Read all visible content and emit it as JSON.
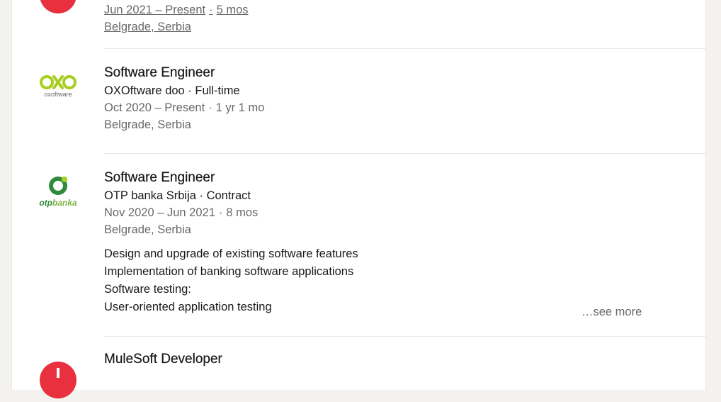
{
  "entries": [
    {
      "dates": "Jun 2021 – Present",
      "separator": "·",
      "duration": "5 mos",
      "location": "Belgrade, Serbia",
      "logo_color": "#e8303e"
    },
    {
      "title": "Software Engineer",
      "company": "OXOftware doo · Full-time",
      "dates": "Oct 2020 – Present",
      "separator": "·",
      "duration": "1 yr 1 mo",
      "location": "Belgrade, Serbia",
      "logo_text": "oxoftware",
      "logo_color": "#a6cf1f"
    },
    {
      "title": "Software Engineer",
      "company": "OTP banka Srbija · Contract",
      "dates": "Nov 2020 – Jun 2021",
      "separator": "·",
      "duration": "8 mos",
      "location": "Belgrade, Serbia",
      "logo_text_a": "otp",
      "logo_text_b": "banka",
      "logo_color": "#2f8a3c",
      "description": [
        "Design and upgrade of existing software features",
        "Implementation of banking software applications",
        "Software testing:",
        "User-oriented application testing"
      ],
      "see_more": "…see more"
    },
    {
      "title": "MuleSoft Developer",
      "logo_color": "#e8303e"
    }
  ]
}
